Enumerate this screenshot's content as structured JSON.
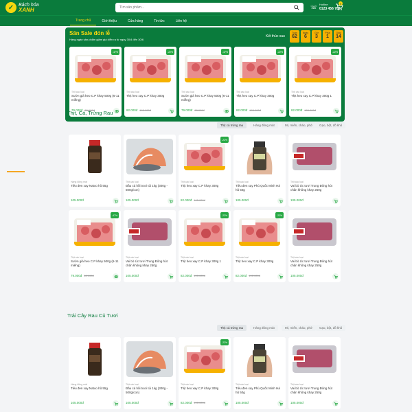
{
  "header": {
    "logo_top": "Bách hóa",
    "logo_bottom": "XANH",
    "search_placeholder": "Tìm sản phẩm...",
    "hotline_label": "Hotline",
    "hotline_number": "0123 456 789",
    "cart_count": "0"
  },
  "nav": [
    "Trang chủ",
    "Giới thiệu",
    "Cửa hàng",
    "Tin tức",
    "Liên hệ"
  ],
  "sale": {
    "title": "Săn Sale đón lễ",
    "subtitle": "Hàng ngàn sản phẩm giảm giá diễn ra từ ngày 30/4 đến 30/6",
    "ends_label": "Kết thúc sau",
    "timer": [
      {
        "unit": "Tuần",
        "value": "62"
      },
      {
        "unit": "Ngày",
        "value": "6"
      },
      {
        "unit": "Giờ",
        "value": "3"
      },
      {
        "unit": "Phút",
        "value": "1"
      },
      {
        "unit": "Giây",
        "value": "14"
      }
    ]
  },
  "sale_products": [
    {
      "badge": "-47%",
      "cat": "Thịt các loại",
      "name": "Sườn già heo C.P khay 500g (6-11 miếng)",
      "price": "79.000đ",
      "old": "83.000đ",
      "icon": "link"
    },
    {
      "badge": "-22%",
      "cat": "Thịt các loại",
      "name": "Thịt heo xay C.P khay 300g",
      "price": "82.000đ",
      "old": "105.000đ",
      "icon": "cart"
    },
    {
      "badge": "-47%",
      "cat": "Thịt các loại",
      "name": "Sườn già heo C.P khay 500g (6-11 miếng)",
      "price": "79.000đ",
      "old": "83.000đ",
      "icon": "link"
    },
    {
      "badge": "-22%",
      "cat": "Thịt các loại",
      "name": "Thịt heo xay C.P khay 300g",
      "price": "82.000đ",
      "old": "105.000đ",
      "icon": "cart"
    },
    {
      "badge": "-22%",
      "cat": "Thịt các loại",
      "name": "Thịt heo xay C.P khay 300g 1",
      "price": "82.000đ",
      "old": "105.000đ",
      "icon": "cart"
    }
  ],
  "section1": {
    "title": "Thịt, Cá, Trứng Rau",
    "tabs": [
      "Thịt cá trứng rau",
      "Hàng đông mát",
      "Mì, miến, cháo, phở",
      "Gạo, bột, đồ khô"
    ]
  },
  "section1_products": [
    {
      "badge": "",
      "cat": "Hàng đông mát",
      "name": "Tiêu đen xay Natoo hũ 55g",
      "price": "105.000đ",
      "old": "",
      "icon": "cart",
      "img": "pepper"
    },
    {
      "badge": "",
      "cat": "Thịt các loại",
      "name": "Đầu cá hồi tươi túi 1kg (300g - 500g/con)",
      "price": "105.000đ",
      "old": "",
      "icon": "cart",
      "img": "fish"
    },
    {
      "badge": "-22%",
      "cat": "Thịt các loại",
      "name": "Thịt heo xay C.P khay 300g",
      "price": "82.000đ",
      "old": "105.000đ",
      "icon": "cart",
      "img": "pack"
    },
    {
      "badge": "",
      "cat": "Thịt các loại",
      "name": "Tiêu đen xay Phú Quốc Minh Hà hũ 50g",
      "price": "105.000đ",
      "old": "",
      "icon": "cart",
      "img": "jar"
    },
    {
      "badge": "",
      "cat": "Thịt các loại",
      "name": "Vai bò Úc tươi Trung Đông hút chân không khay 250g",
      "price": "105.000đ",
      "old": "",
      "icon": "cart",
      "img": "beef"
    },
    {
      "badge": "-47%",
      "cat": "Thịt các loại",
      "name": "Sườn già heo C.P khay 500g (6-11 miếng)",
      "price": "79.000đ",
      "old": "83.000đ",
      "icon": "link",
      "img": "pack"
    },
    {
      "badge": "",
      "cat": "Thịt các loại",
      "name": "Vai bò Úc tươi Trung Đông hút chân không khay 250g",
      "price": "105.000đ",
      "old": "",
      "icon": "cart",
      "img": "beef"
    },
    {
      "badge": "-22%",
      "cat": "Thịt các loại",
      "name": "Thịt heo xay C.P khay 300g 1",
      "price": "82.000đ",
      "old": "105.000đ",
      "icon": "cart",
      "img": "pack"
    },
    {
      "badge": "-22%",
      "cat": "Thịt các loại",
      "name": "Thịt heo xay C.P khay 300g",
      "price": "82.000đ",
      "old": "105.000đ",
      "icon": "cart",
      "img": "pack"
    },
    {
      "badge": "",
      "cat": "Thịt các loại",
      "name": "Vai bò Úc tươi Trung Đông hút chân không khay 250g",
      "price": "105.000đ",
      "old": "",
      "icon": "cart",
      "img": "beef"
    }
  ],
  "section2": {
    "title": "Trái Cây Rau Củ Tươi",
    "tabs": [
      "Thịt cá trứng rau",
      "Hàng đông mát",
      "Mì, miến, cháo, phở",
      "Gạo, bột, đồ khô"
    ]
  },
  "section2_products": [
    {
      "badge": "",
      "cat": "Hàng đông mát",
      "name": "Tiêu đen xay Natoo hũ 55g",
      "price": "105.000đ",
      "old": "",
      "icon": "cart",
      "img": "pepper"
    },
    {
      "badge": "",
      "cat": "Thịt các loại",
      "name": "Đầu cá hồi tươi túi 1kg (300g - 500g/con)",
      "price": "105.000đ",
      "old": "",
      "icon": "cart",
      "img": "fish"
    },
    {
      "badge": "-22%",
      "cat": "Thịt các loại",
      "name": "Thịt heo xay C.P khay 300g",
      "price": "82.000đ",
      "old": "105.000đ",
      "icon": "cart",
      "img": "pack"
    },
    {
      "badge": "",
      "cat": "Thịt các loại",
      "name": "Tiêu đen xay Phú Quốc Minh Hà hũ 50g",
      "price": "105.000đ",
      "old": "",
      "icon": "cart",
      "img": "jar"
    },
    {
      "badge": "",
      "cat": "Thịt các loại",
      "name": "Vai bò Úc tươi Trung Đông hút chân không khay 250g",
      "price": "105.000đ",
      "old": "",
      "icon": "cart",
      "img": "beef"
    }
  ],
  "colors": {
    "brand": "#0a7b3c",
    "accent": "#f6d70f",
    "price": "#27a844"
  }
}
